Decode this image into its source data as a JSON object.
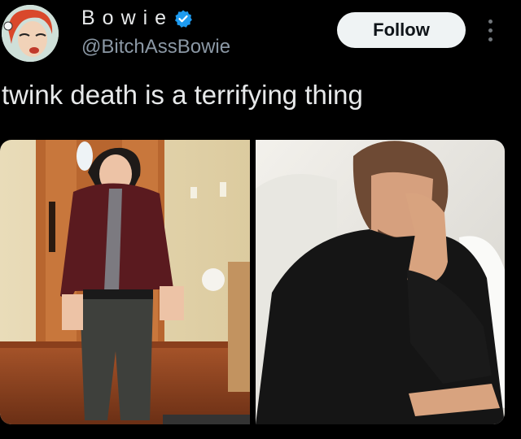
{
  "tweet": {
    "display_name": "Bowie",
    "handle": "@BitchAssBowie",
    "verified": true,
    "follow_label": "Follow",
    "text": "twink death is a terrifying thing",
    "media_count": 2
  },
  "icons": {
    "verified": "verified-badge-icon",
    "more": "more-options-icon"
  },
  "colors": {
    "background": "#000000",
    "text": "#e7e9ea",
    "secondary_text": "#8b98a5",
    "verified_blue": "#1d9bf0",
    "follow_bg": "#eff3f4"
  }
}
